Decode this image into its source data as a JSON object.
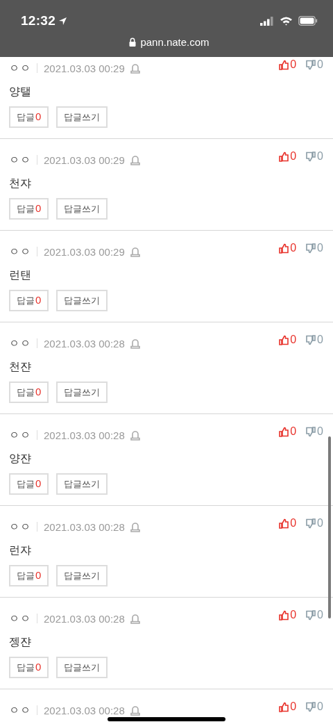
{
  "status_bar": {
    "time": "12:32",
    "url": "pann.nate.com"
  },
  "comments": [
    {
      "author": "ㅇㅇ",
      "date": "2021.03.03 00:29",
      "likes": "0",
      "dislikes": "0",
      "text": "양탤",
      "reply_label": "답글",
      "reply_count": "0",
      "write_label": "답글쓰기"
    },
    {
      "author": "ㅇㅇ",
      "date": "2021.03.03 00:29",
      "likes": "0",
      "dislikes": "0",
      "text": "천쟈",
      "reply_label": "답글",
      "reply_count": "0",
      "write_label": "답글쓰기"
    },
    {
      "author": "ㅇㅇ",
      "date": "2021.03.03 00:29",
      "likes": "0",
      "dislikes": "0",
      "text": "런탠",
      "reply_label": "답글",
      "reply_count": "0",
      "write_label": "답글쓰기"
    },
    {
      "author": "ㅇㅇ",
      "date": "2021.03.03 00:28",
      "likes": "0",
      "dislikes": "0",
      "text": "천쟌",
      "reply_label": "답글",
      "reply_count": "0",
      "write_label": "답글쓰기"
    },
    {
      "author": "ㅇㅇ",
      "date": "2021.03.03 00:28",
      "likes": "0",
      "dislikes": "0",
      "text": "양쟌",
      "reply_label": "답글",
      "reply_count": "0",
      "write_label": "답글쓰기"
    },
    {
      "author": "ㅇㅇ",
      "date": "2021.03.03 00:28",
      "likes": "0",
      "dislikes": "0",
      "text": "런쟈",
      "reply_label": "답글",
      "reply_count": "0",
      "write_label": "답글쓰기"
    },
    {
      "author": "ㅇㅇ",
      "date": "2021.03.03 00:28",
      "likes": "0",
      "dislikes": "0",
      "text": "젱쟌",
      "reply_label": "답글",
      "reply_count": "0",
      "write_label": "답글쓰기"
    },
    {
      "author": "ㅇㅇ",
      "date": "2021.03.03 00:28",
      "likes": "0",
      "dislikes": "0"
    }
  ]
}
